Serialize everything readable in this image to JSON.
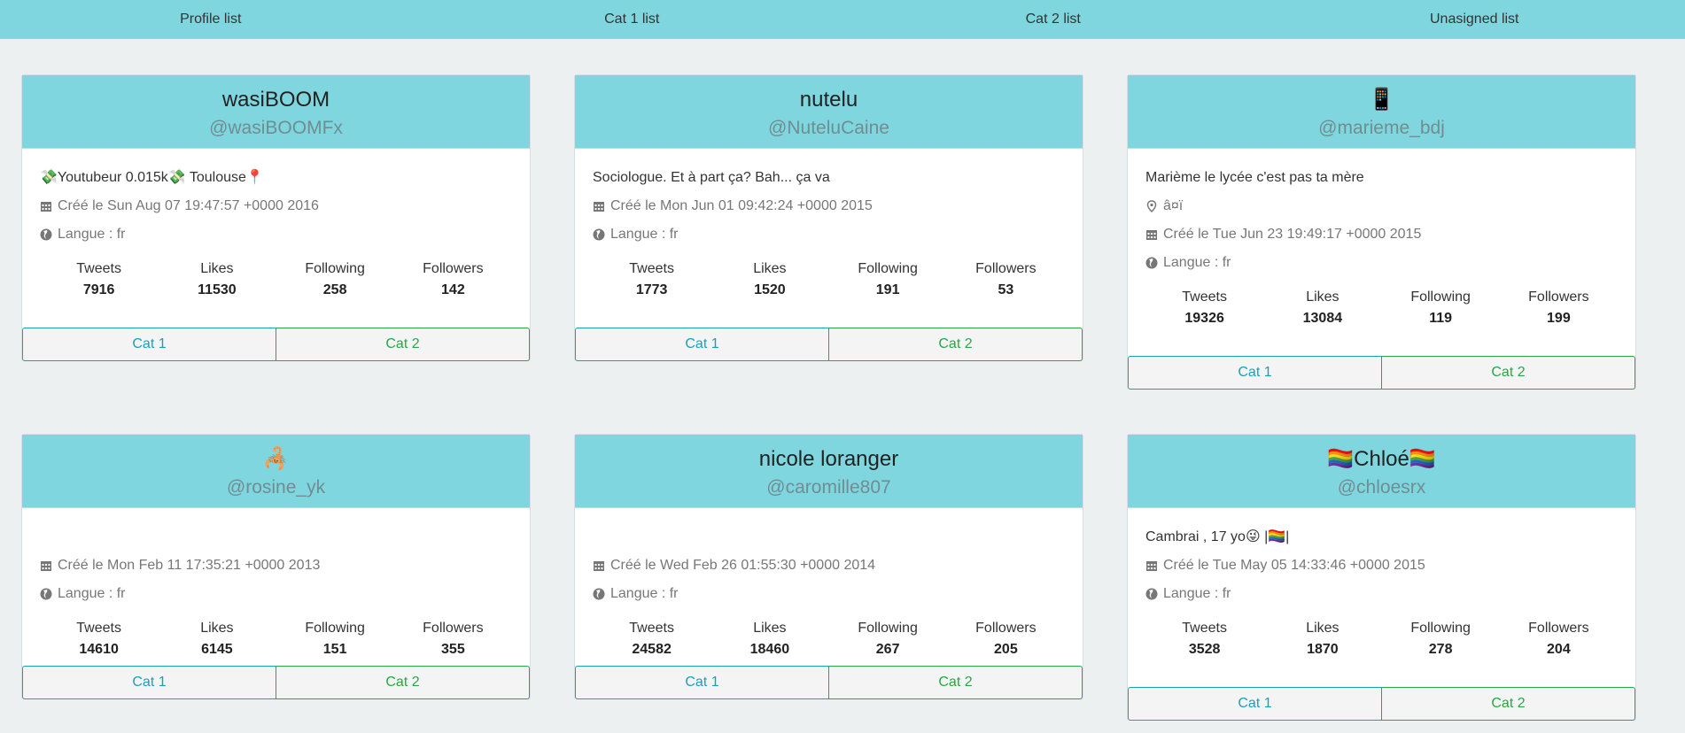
{
  "nav": {
    "items": [
      "Profile list",
      "Cat 1 list",
      "Cat 2 list",
      "Unasigned list"
    ]
  },
  "labels": {
    "tweets": "Tweets",
    "likes": "Likes",
    "following": "Following",
    "followers": "Followers",
    "cat1": "Cat 1",
    "cat2": "Cat 2"
  },
  "colors": {
    "header": "#7fd6df",
    "background": "#ecf0f1",
    "cat1": "#17a2b8",
    "cat2": "#28a745"
  },
  "profiles": [
    {
      "name": "wasiBOOM",
      "handle": "@wasiBOOMFx",
      "bio": "💸Youtubeur 0.015k💸 Toulouse📍",
      "created": "Créé le Sun Aug 07 19:47:57 +0000 2016",
      "language": "Langue : fr",
      "tweets": "7916",
      "likes": "11530",
      "following": "258",
      "followers": "142"
    },
    {
      "name": "nutelu",
      "handle": "@NuteluCaine",
      "bio": "Sociologue. Et à part ça? Bah... ça va",
      "created": "Créé le Mon Jun 01 09:42:24 +0000 2015",
      "language": "Langue : fr",
      "tweets": "1773",
      "likes": "1520",
      "following": "191",
      "followers": "53"
    },
    {
      "name": "📱",
      "handle": "@marieme_bdj",
      "bio": "Marième le lycée c'est pas ta mère",
      "location": "â¤ï",
      "created": "Créé le Tue Jun 23 19:49:17 +0000 2015",
      "language": "Langue : fr",
      "tweets": "19326",
      "likes": "13084",
      "following": "119",
      "followers": "199"
    },
    {
      "name": "🦂",
      "handle": "@rosine_yk",
      "bio": "",
      "created": "Créé le Mon Feb 11 17:35:21 +0000 2013",
      "language": "Langue : fr",
      "tweets": "14610",
      "likes": "6145",
      "following": "151",
      "followers": "355"
    },
    {
      "name": "nicole loranger",
      "handle": "@caromille807",
      "bio": "",
      "created": "Créé le Wed Feb 26 01:55:30 +0000 2014",
      "language": "Langue : fr",
      "tweets": "24582",
      "likes": "18460",
      "following": "267",
      "followers": "205"
    },
    {
      "name": "🏳️‍🌈Chloé🏳️‍🌈",
      "handle": "@chloesrx",
      "bio": "Cambrai , 17 yo😜 |🏳️‍🌈|",
      "created": "Créé le Tue May 05 14:33:46 +0000 2015",
      "language": "Langue : fr",
      "tweets": "3528",
      "likes": "1870",
      "following": "278",
      "followers": "204"
    }
  ]
}
